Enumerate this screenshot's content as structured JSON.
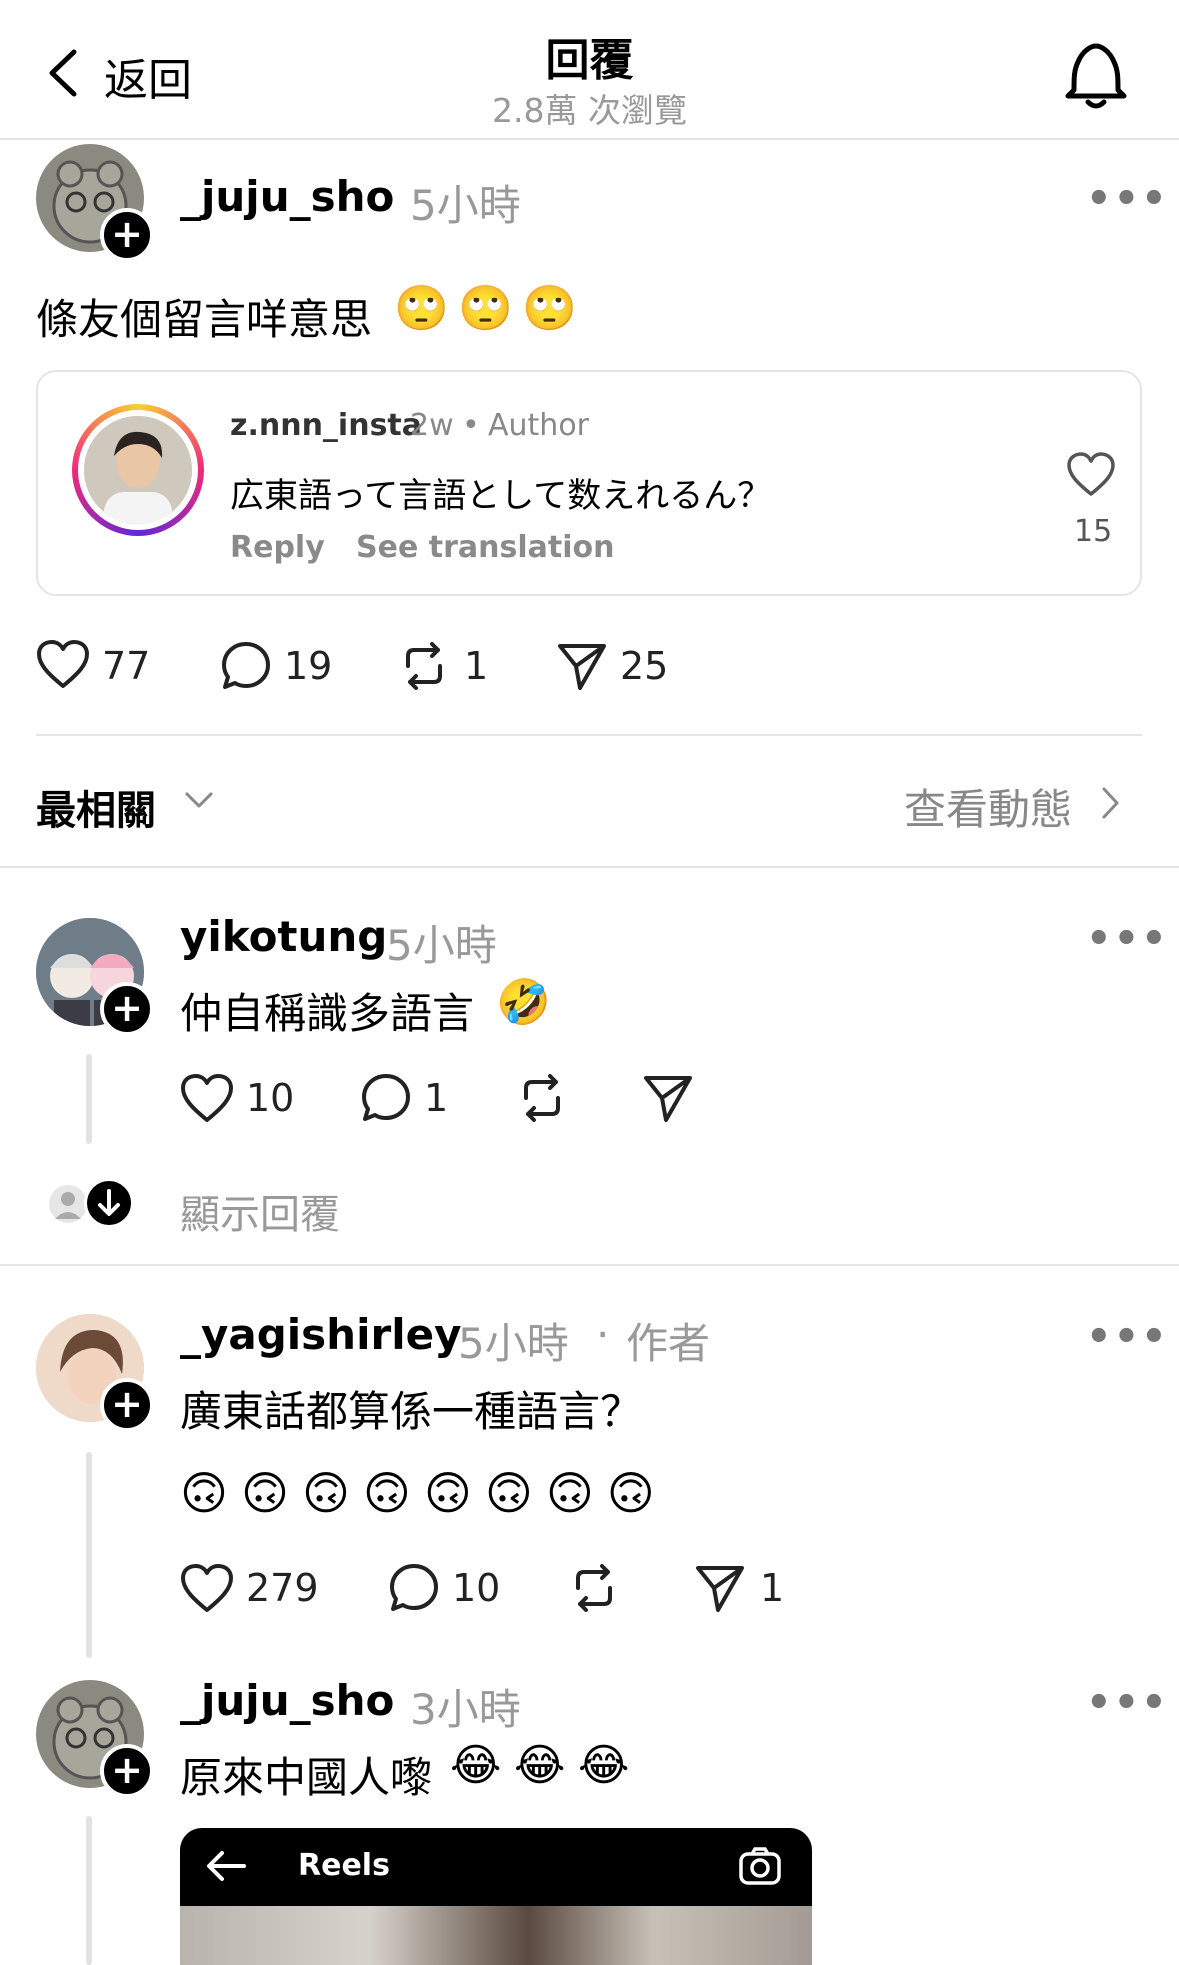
{
  "header": {
    "back_label": "返回",
    "title": "回覆",
    "subtitle": "2.8萬 次瀏覽"
  },
  "post": {
    "username": "_juju_sho",
    "time": "5小時",
    "text": "條友個留言咩意思",
    "emoji": [
      "🙄",
      "🙄",
      "🙄"
    ],
    "quote": {
      "username": "z.nnn_insta",
      "age": "2w",
      "dot": "•",
      "role": "Author",
      "text": "広東語って言語として数えれるん？",
      "reply_label": "Reply",
      "translate_label": "See translation",
      "likes": "15"
    },
    "actions": {
      "likes": "77",
      "comments": "19",
      "reposts": "1",
      "shares": "25"
    }
  },
  "sort": {
    "label": "最相關",
    "activity_label": "查看動態"
  },
  "replies": [
    {
      "username": "yikotung",
      "time": "5小時",
      "text": "仲自稱識多語言",
      "emoji": "🤣",
      "actions": {
        "likes": "10",
        "comments": "1"
      },
      "show_replies_label": "顯示回覆"
    },
    {
      "username": "_yagishirley",
      "time": "5小時",
      "separator": "·",
      "role": "作者",
      "text": "廣東話都算係一種語言？",
      "emoji_row": [
        "🙃",
        "🙃",
        "🙃",
        "🙃",
        "🙃",
        "🙃",
        "🙃",
        "🙃"
      ],
      "actions": {
        "likes": "279",
        "comments": "10",
        "shares": "1"
      }
    },
    {
      "username": "_juju_sho",
      "time": "3小時",
      "text": "原來中國人嚟",
      "emoji": [
        "😂",
        "😂",
        "😂"
      ],
      "reel_title": "Reels"
    }
  ],
  "colors": {
    "muted": "#999999",
    "divider": "#e4e4e4",
    "text": "#000000"
  }
}
